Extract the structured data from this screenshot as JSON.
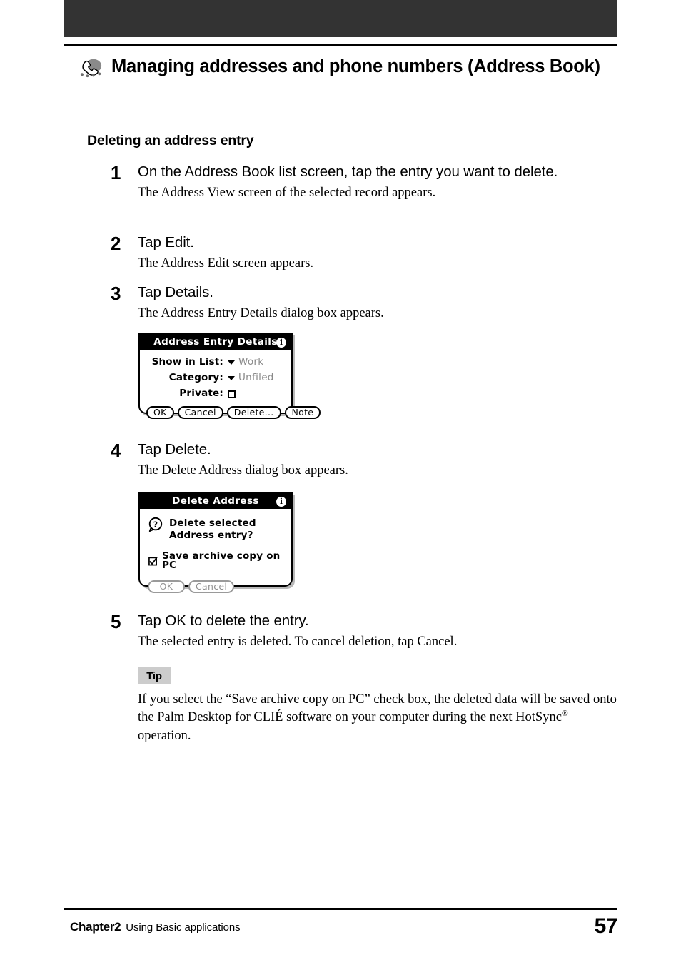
{
  "header": {
    "icon": "address-book-phone-icon",
    "title": "Managing addresses and phone numbers (Address Book)"
  },
  "section": {
    "heading": "Deleting an address entry"
  },
  "steps": [
    {
      "number": "1",
      "title": "On the Address Book list screen, tap the entry you want to delete.",
      "description": "The Address View screen of the selected record appears."
    },
    {
      "number": "2",
      "title": "Tap Edit.",
      "description": "The Address Edit screen appears."
    },
    {
      "number": "3",
      "title": "Tap Details.",
      "description": "The Address Entry Details dialog box appears."
    },
    {
      "number": "4",
      "title": "Tap Delete.",
      "description": "The Delete Address dialog box appears."
    },
    {
      "number": "5",
      "title": "Tap OK to delete the entry.",
      "description": "The selected entry is deleted. To cancel deletion, tap Cancel."
    }
  ],
  "details_dialog": {
    "title": "Address Entry Details",
    "info_icon": "info-icon",
    "fields": [
      {
        "label": "Show in List:",
        "value": "Work",
        "control": "dropdown"
      },
      {
        "label": "Category:",
        "value": "Unfiled",
        "control": "dropdown"
      },
      {
        "label": "Private:",
        "value": "",
        "control": "checkbox-unchecked"
      }
    ],
    "buttons": [
      {
        "label": "OK"
      },
      {
        "label": "Cancel"
      },
      {
        "label": "Delete..."
      },
      {
        "label": "Note"
      }
    ]
  },
  "delete_dialog": {
    "title": "Delete Address",
    "info_icon": "info-icon",
    "question_icon": "question-mark-icon",
    "message_line1": "Delete selected",
    "message_line2": "Address entry?",
    "checkbox": {
      "label": "Save archive copy on PC",
      "checked": true
    },
    "buttons": [
      {
        "label": "OK"
      },
      {
        "label": "Cancel"
      }
    ]
  },
  "tip": {
    "badge": "Tip",
    "text_part1": "If you select the “Save archive copy on PC” check box, the deleted data will be saved onto the Palm Desktop for CLIÉ software on your computer during the next HotSync",
    "registered_mark": "®",
    "text_part2": " operation."
  },
  "footer": {
    "chapter": "Chapter2",
    "subtitle": "Using Basic applications",
    "page_number": "57"
  },
  "colors": {
    "top_band": "#333333",
    "tip_badge_bg": "#cccccc",
    "dialog_title_bg": "#000000",
    "dialog_value_text": "#8a8a8a"
  }
}
